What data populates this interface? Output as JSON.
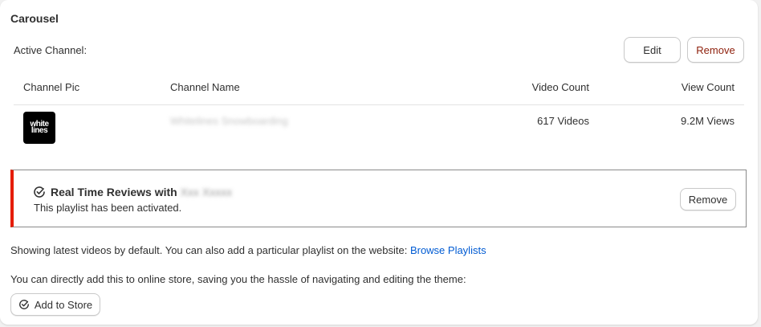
{
  "section": {
    "title": "Carousel"
  },
  "active_channel": {
    "label": "Active Channel:",
    "edit_label": "Edit",
    "remove_label": "Remove"
  },
  "table": {
    "headers": [
      "Channel Pic",
      "Channel Name",
      "Video Count",
      "View Count"
    ],
    "rows": [
      {
        "avatar_text": "white lines",
        "name": "Whitelines Snowboarding",
        "video_count": "617 Videos",
        "view_count": "9.2M Views"
      }
    ]
  },
  "banner": {
    "icon": "check-circle-icon",
    "title": "Real Time Reviews with",
    "title_redacted": "Xxx Xxxxx",
    "subtitle": "This playlist has been activated.",
    "remove_label": "Remove",
    "accent_color": "#e51c00"
  },
  "info": {
    "text1": "Showing latest videos by default. You can also add a particular playlist on the website:",
    "link_label": "Browse Playlists",
    "text2": "You can directly add this to online store, saving you the hassle of navigating and editing the theme:",
    "add_label": "Add to Store",
    "add_icon": "check-circle-icon"
  }
}
